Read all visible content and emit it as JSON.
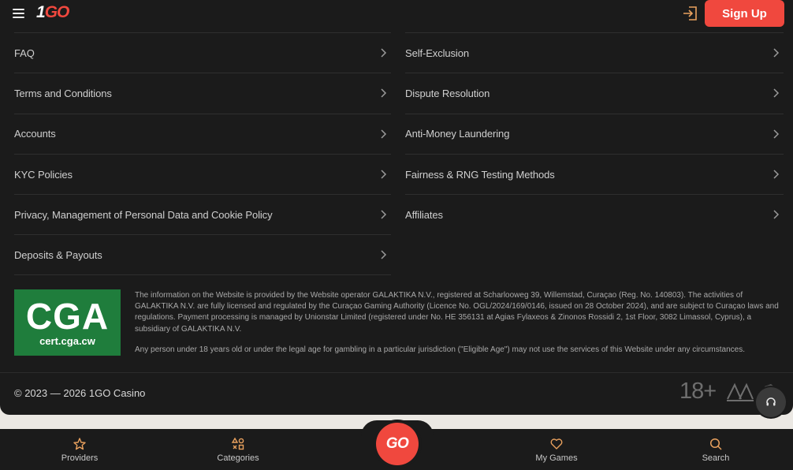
{
  "header": {
    "logo_one": "1",
    "logo_go": "GO",
    "signup_label": "Sign Up"
  },
  "links": {
    "left": [
      {
        "label": "FAQ"
      },
      {
        "label": "Terms and Conditions"
      },
      {
        "label": "Accounts"
      },
      {
        "label": "KYC Policies"
      },
      {
        "label": "Privacy, Management of Personal Data and Cookie Policy"
      },
      {
        "label": "Deposits & Payouts"
      }
    ],
    "right": [
      {
        "label": "Self-Exclusion"
      },
      {
        "label": "Dispute Resolution"
      },
      {
        "label": "Anti-Money Laundering"
      },
      {
        "label": "Fairness & RNG Testing Methods"
      },
      {
        "label": "Affiliates"
      }
    ]
  },
  "license": {
    "logo_big": "CGA",
    "logo_small": "cert.cga.cw",
    "paragraph1": "The information on the Website is provided by the Website operator GALAKTIKA N.V., registered at Scharlooweg 39, Willemstad, Curaçao (Reg. No. 140803). The activities of GALAKTIKA N.V. are fully licensed and regulated by the Curaçao Gaming Authority (Licence No. OGL/2024/169/0146, issued on 28 October 2024), and are subject to Curaçao laws and regulations. Payment processing is managed by Unionstar Limited (registered under No. HE 356131 at Agias Fylaxeos & Zinonos Rossidi 2, 1st Floor, 3082 Limassol, Cyprus), a subsidiary of GALAKTIKA N.V.",
    "paragraph2": "Any person under 18 years old or under the legal age for gambling in a particular jurisdiction (\"Eligible Age\") may not use the services of this Website under any circumstances."
  },
  "footer": {
    "copyright": "© 2023 — 2026 1GO Casino",
    "age_badge": "18+"
  },
  "nav": {
    "providers": "Providers",
    "categories": "Categories",
    "go": "GO",
    "my_games": "My Games",
    "search": "Search"
  },
  "colors": {
    "accent": "#f0483e",
    "background": "#1b1b1b",
    "cga_green": "#1f7d3c"
  }
}
